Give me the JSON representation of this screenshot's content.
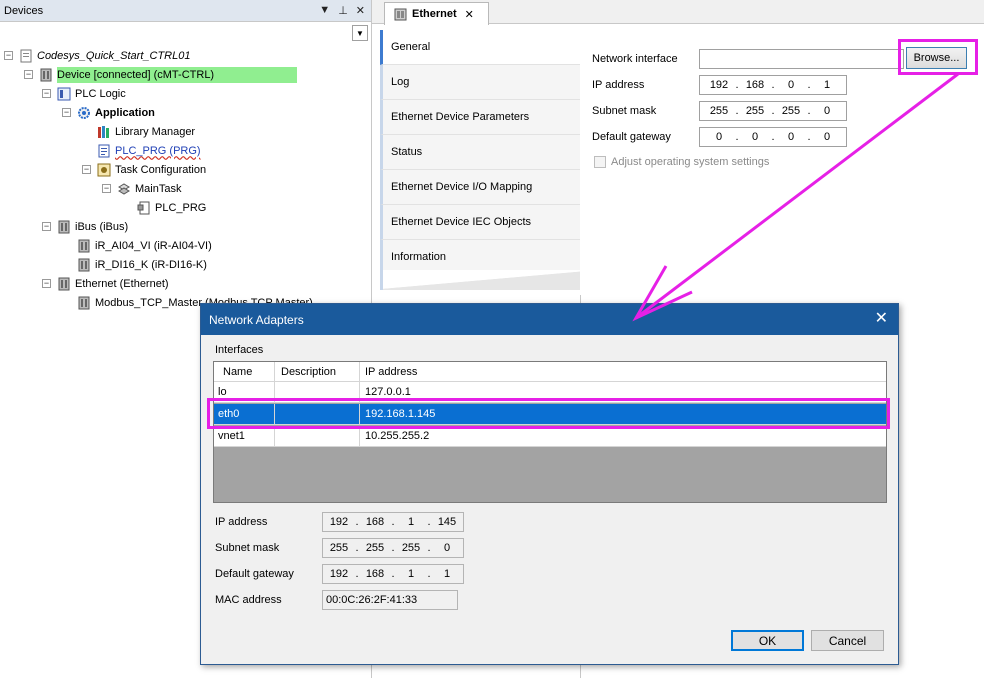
{
  "devices_panel": {
    "title": "Devices",
    "header_controls": {
      "dropdown": "▼",
      "pin": "⊥",
      "close": "✕"
    },
    "tree": [
      {
        "label": "Codesys_Quick_Start_CTRL01",
        "icon": "project-icon",
        "expander": "−",
        "style": "italic"
      },
      {
        "label": "Device [connected] (cMT-CTRL)",
        "icon": "device-icon",
        "expander": "−",
        "style": "highlight"
      },
      {
        "label": "PLC Logic",
        "icon": "plc-logic-icon",
        "expander": "−",
        "style": "normal"
      },
      {
        "label": "Application",
        "icon": "application-gear-icon",
        "expander": "−",
        "style": "bold"
      },
      {
        "label": "Library Manager",
        "icon": "library-books-icon",
        "expander": "",
        "style": "normal"
      },
      {
        "label": "PLC_PRG (PRG)",
        "icon": "program-document-icon",
        "expander": "",
        "style": "link"
      },
      {
        "label": "Task Configuration",
        "icon": "task-config-icon",
        "expander": "−",
        "style": "normal"
      },
      {
        "label": "MainTask",
        "icon": "task-icon",
        "expander": "−",
        "style": "normal"
      },
      {
        "label": "PLC_PRG",
        "icon": "program-call-icon",
        "expander": "",
        "style": "normal"
      },
      {
        "label": "iBus (iBus)",
        "icon": "bus-module-icon",
        "expander": "−",
        "style": "normal"
      },
      {
        "label": "iR_AI04_VI (iR-AI04-VI)",
        "icon": "io-module-icon",
        "expander": "",
        "style": "normal"
      },
      {
        "label": "iR_DI16_K (iR-DI16-K)",
        "icon": "io-module-icon",
        "expander": "",
        "style": "normal"
      },
      {
        "label": "Ethernet (Ethernet)",
        "icon": "ethernet-module-icon",
        "expander": "−",
        "style": "normal"
      },
      {
        "label": "Modbus_TCP_Master (Modbus TCP Master)",
        "icon": "modbus-module-icon",
        "expander": "",
        "style": "normal"
      }
    ]
  },
  "editor": {
    "tab_label": "Ethernet",
    "tab_close": "✕",
    "side_tabs": [
      "General",
      "Log",
      "Ethernet Device Parameters",
      "Status",
      "Ethernet Device I/O Mapping",
      "Ethernet Device IEC Objects",
      "Information"
    ],
    "general": {
      "network_interface_label": "Network interface",
      "network_interface_value": "",
      "browse_label": "Browse...",
      "ip_label": "IP address",
      "ip": [
        "192",
        "168",
        "0",
        "1"
      ],
      "subnet_label": "Subnet mask",
      "subnet": [
        "255",
        "255",
        "255",
        "0"
      ],
      "gateway_label": "Default gateway",
      "gateway": [
        "0",
        "0",
        "0",
        "0"
      ],
      "adjust_label": "Adjust operating system settings",
      "adjust_checked": false
    }
  },
  "dialog": {
    "title": "Network Adapters",
    "close": "✕",
    "interfaces_label": "Interfaces",
    "columns": [
      "Name",
      "Description",
      "IP address"
    ],
    "rows": [
      {
        "name": "lo",
        "description": "",
        "ip": "127.0.0.1",
        "selected": false
      },
      {
        "name": "eth0",
        "description": "",
        "ip": "192.168.1.145",
        "selected": true
      },
      {
        "name": "vnet1",
        "description": "",
        "ip": "10.255.255.2",
        "selected": false
      }
    ],
    "ip_label": "IP address",
    "ip": [
      "192",
      "168",
      "1",
      "145"
    ],
    "subnet_label": "Subnet mask",
    "subnet": [
      "255",
      "255",
      "255",
      "0"
    ],
    "gateway_label": "Default gateway",
    "gateway": [
      "192",
      "168",
      "1",
      "1"
    ],
    "mac_label": "MAC address",
    "mac": "00:0C:26:2F:41:33",
    "ok_label": "OK",
    "cancel_label": "Cancel"
  },
  "colors": {
    "annotation": "#e620e6",
    "selection": "#0a6fd2",
    "connected_highlight": "#90ee90",
    "dialog_title_bar": "#1a5a9c"
  }
}
